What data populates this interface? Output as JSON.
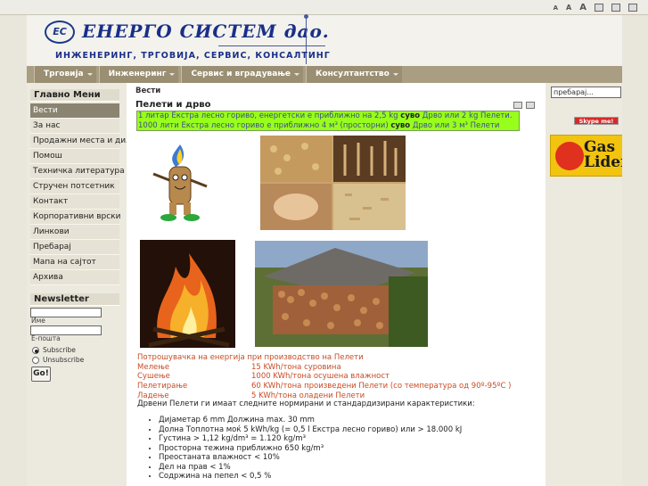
{
  "top_tools": {
    "font_small": "A",
    "font_medium": "A",
    "font_large": "A"
  },
  "header": {
    "logo_mark": "EC",
    "company_name": "ЕНЕРГО СИСТЕМ дао.",
    "tagline": "ИНЖЕНЕРИНГ, ТРГОВИЈА, СЕРВИС, КОНСАЛТИНГ"
  },
  "nav": {
    "items": [
      "Трговија",
      "Инженеринг",
      "Сервис и вградување",
      "Консултантство"
    ]
  },
  "sidebar": {
    "main_menu_title": "Главно Мени",
    "items": [
      "Вести",
      "За нас",
      "Продажни места и дилери",
      "Помош",
      "Техничка литература",
      "Стручен потсетник",
      "Контакт",
      "Корпоративни врски",
      "Линкови",
      "Пребарај",
      "Мапа на сајтот",
      "Архива"
    ],
    "active_index": 0,
    "newsletter_title": "Newsletter",
    "name_label": "Име",
    "email_label": "Е-пошта",
    "subscribe_label": "Subscribe",
    "unsubscribe_label": "Unsubscribe",
    "go_label": "Go!"
  },
  "main": {
    "breadcrumb": "Вести",
    "title": "Пелети и дрво",
    "highlight_line1_a": "1 литар Екстра лесно гориво, енергетски е приближно на 2,5 kg ",
    "highlight_line1_b": "суво",
    "highlight_line1_c": " Дрво или 2 kg Пелети.",
    "highlight_line2_a": "1000 лити Екстра лесно гориво е приближно 4 м³ (просторни) ",
    "highlight_line2_b": "суво",
    "highlight_line2_c": " Дрво или 3 м³ Пелети",
    "energy_heading": "Потрошувачка на енергија при производство на Пелети",
    "energy_rows": [
      {
        "label": "Мелење",
        "value": "15 KWh/тона суровина"
      },
      {
        "label": "Сушење",
        "value": "1000 KWh/тона осушена влажност"
      },
      {
        "label": "Пелетирање",
        "value": "60 KWh/тона произведени Пелети (со температура од 90º-95ºC )"
      },
      {
        "label": "Ладење",
        "value": "5 KWh/тона оладени Пелети"
      }
    ],
    "intro": "Дрвени Пелети ги имаат следните нормирани и стандардизирани карактеристики:",
    "bullets": [
      "Дијаметар 6 mm Должина max. 30 mm",
      "Долна Топлотна моќ 5 kWh/kg (= 0,5 l Екстра лесно гориво) или > 18.000 kJ",
      "Густина > 1,12 kg/dm³ = 1.120 kg/m³",
      "Просторна тежина приближно 650 kg/m³",
      "Преостаната влажност < 10%",
      "Дел на прав < 1%",
      "Содржина на пепел < 0,5 %"
    ]
  },
  "right": {
    "search_placeholder": "пребарај...",
    "skype_label": "Skype me!",
    "gas_line1": "Gas",
    "gas_line2": "Lider"
  },
  "colors": {
    "accent_nav": "#9a8f73",
    "highlight": "#98ff1c",
    "energy_text": "#c84b24"
  }
}
